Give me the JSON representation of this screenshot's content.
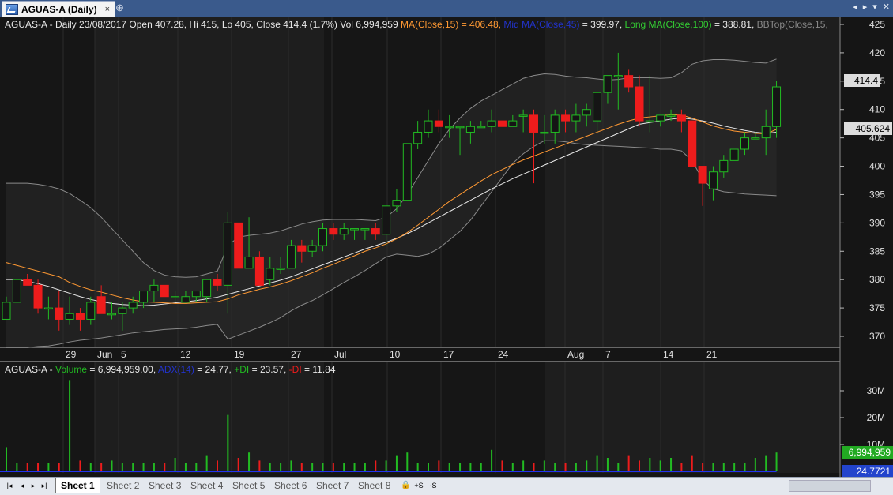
{
  "window": {
    "tab_title": "AGUAS-A (Daily)",
    "tab_icon": "chart-icon",
    "close_glyph": "×",
    "pin_glyph": "⊕",
    "controls": [
      "◂",
      "▸",
      "▾",
      "✕"
    ]
  },
  "price_pane": {
    "info": {
      "main": "AGUAS-A - Daily 23/08/2017 Open 407.28, Hi 415, Lo 405, Close 414.4 (1.7%) Vol 6,994,959",
      "ma15": "MA(Close,15) = 406.48,",
      "mid_ma": "Mid MA(Close,45)",
      "mid_ma_val": "= 399.97,",
      "long_ma": "Long MA(Close,100)",
      "long_ma_val": "= 388.81,",
      "bbtop": "BBTop(Close,15,"
    },
    "y_ticks": [
      "425",
      "420",
      "415",
      "410",
      "405",
      "400",
      "395",
      "390",
      "385",
      "380",
      "375",
      "370"
    ],
    "last_price": "414.4",
    "ma_marker": "405.624",
    "x_labels": [
      "29",
      "Jun",
      "5",
      "12",
      "19",
      "27",
      "Jul",
      "10",
      "17",
      "24",
      "Aug",
      "7",
      "14",
      "21"
    ]
  },
  "volume_pane": {
    "info": {
      "name": "AGUAS-A -",
      "volume_label": "Volume",
      "volume_val": "= 6,994,959.00,",
      "adx_label": "ADX(14)",
      "adx_val": "= 24.77,",
      "pdi_label": "+DI",
      "pdi_val": "= 23.57,",
      "mdi_label": "-DI",
      "mdi_val": "= 11.84"
    },
    "y_ticks": [
      "30M",
      "20M",
      "10M"
    ],
    "last_volume": "6,994,959",
    "last_adx": "24.7721"
  },
  "colors": {
    "up": "#22bb22",
    "down": "#ee1c1c",
    "ma15": "#ff9933",
    "mid_ma": "#2233cc",
    "long_ma": "#33cc33",
    "bb": "#888888",
    "price_box": "#dddddd",
    "adx_box": "#2244cc",
    "volume_box": "#22aa22"
  },
  "sheets": {
    "nav": [
      "|◂",
      "◂",
      "▸",
      "▸|"
    ],
    "tabs": [
      "Sheet 1",
      "Sheet 2",
      "Sheet 3",
      "Sheet 4",
      "Sheet 5",
      "Sheet 6",
      "Sheet 7",
      "Sheet 8"
    ],
    "active": "Sheet 1",
    "tools": [
      "🔒",
      "+S",
      "-S"
    ]
  },
  "chart_data": {
    "type": "candlestick",
    "symbol": "AGUAS-A",
    "interval": "Daily",
    "ylim": [
      367,
      426
    ],
    "volume_ylim": [
      0,
      35000000
    ],
    "candles": [
      {
        "o": 373,
        "h": 377,
        "l": 373,
        "c": 376
      },
      {
        "o": 376,
        "h": 380,
        "l": 376,
        "c": 380
      },
      {
        "o": 380,
        "h": 381,
        "l": 379,
        "c": 379
      },
      {
        "o": 379,
        "h": 380,
        "l": 374,
        "c": 375
      },
      {
        "o": 375,
        "h": 377,
        "l": 373,
        "c": 375
      },
      {
        "o": 375,
        "h": 378,
        "l": 371,
        "c": 373
      },
      {
        "o": 373,
        "h": 377,
        "l": 372,
        "c": 374
      },
      {
        "o": 374,
        "h": 375,
        "l": 371,
        "c": 373
      },
      {
        "o": 373,
        "h": 377,
        "l": 372,
        "c": 376
      },
      {
        "o": 377,
        "h": 379,
        "l": 375,
        "c": 374
      },
      {
        "o": 374,
        "h": 376,
        "l": 373,
        "c": 374
      },
      {
        "o": 374,
        "h": 376,
        "l": 371,
        "c": 375
      },
      {
        "o": 375,
        "h": 377,
        "l": 374,
        "c": 376
      },
      {
        "o": 376,
        "h": 378,
        "l": 375,
        "c": 378
      },
      {
        "o": 378,
        "h": 380,
        "l": 376,
        "c": 379
      },
      {
        "o": 379,
        "h": 379,
        "l": 377,
        "c": 377
      },
      {
        "o": 377,
        "h": 378,
        "l": 376,
        "c": 377
      },
      {
        "o": 376,
        "h": 378,
        "l": 376,
        "c": 377
      },
      {
        "o": 377,
        "h": 378,
        "l": 376,
        "c": 378
      },
      {
        "o": 377,
        "h": 380,
        "l": 376,
        "c": 380
      },
      {
        "o": 380,
        "h": 381,
        "l": 378,
        "c": 379
      },
      {
        "o": 379,
        "h": 392,
        "l": 374,
        "c": 390
      },
      {
        "o": 390,
        "h": 390,
        "l": 382,
        "c": 382
      },
      {
        "o": 382,
        "h": 391,
        "l": 382,
        "c": 384
      },
      {
        "o": 384,
        "h": 385,
        "l": 379,
        "c": 379
      },
      {
        "o": 380,
        "h": 384,
        "l": 379,
        "c": 382
      },
      {
        "o": 382,
        "h": 384,
        "l": 381,
        "c": 382
      },
      {
        "o": 382,
        "h": 387,
        "l": 382,
        "c": 386
      },
      {
        "o": 386,
        "h": 387,
        "l": 383,
        "c": 385
      },
      {
        "o": 385,
        "h": 387,
        "l": 384,
        "c": 386
      },
      {
        "o": 386,
        "h": 390,
        "l": 385,
        "c": 389
      },
      {
        "o": 389,
        "h": 390,
        "l": 387,
        "c": 388
      },
      {
        "o": 388,
        "h": 390,
        "l": 387,
        "c": 389
      },
      {
        "o": 389,
        "h": 389,
        "l": 387,
        "c": 389
      },
      {
        "o": 389,
        "h": 389,
        "l": 387,
        "c": 389
      },
      {
        "o": 389,
        "h": 390,
        "l": 387,
        "c": 388
      },
      {
        "o": 388,
        "h": 393,
        "l": 386,
        "c": 393
      },
      {
        "o": 393,
        "h": 396,
        "l": 392,
        "c": 394
      },
      {
        "o": 394,
        "h": 404,
        "l": 394,
        "c": 404
      },
      {
        "o": 404,
        "h": 408,
        "l": 403,
        "c": 406
      },
      {
        "o": 406,
        "h": 410,
        "l": 405,
        "c": 408
      },
      {
        "o": 408,
        "h": 410,
        "l": 406,
        "c": 407
      },
      {
        "o": 407,
        "h": 409,
        "l": 405,
        "c": 407
      },
      {
        "o": 407,
        "h": 407,
        "l": 402,
        "c": 407
      },
      {
        "o": 406,
        "h": 408,
        "l": 404,
        "c": 407
      },
      {
        "o": 407,
        "h": 408,
        "l": 407,
        "c": 407
      },
      {
        "o": 407,
        "h": 410,
        "l": 406,
        "c": 408
      },
      {
        "o": 408,
        "h": 408,
        "l": 407,
        "c": 407
      },
      {
        "o": 407,
        "h": 409,
        "l": 407,
        "c": 408
      },
      {
        "o": 409,
        "h": 410,
        "l": 406,
        "c": 409
      },
      {
        "o": 409,
        "h": 410,
        "l": 397,
        "c": 406
      },
      {
        "o": 406,
        "h": 409,
        "l": 404,
        "c": 406
      },
      {
        "o": 406,
        "h": 410,
        "l": 404,
        "c": 409
      },
      {
        "o": 409,
        "h": 410,
        "l": 406,
        "c": 408
      },
      {
        "o": 408,
        "h": 411,
        "l": 406,
        "c": 409
      },
      {
        "o": 409,
        "h": 411,
        "l": 407,
        "c": 410
      },
      {
        "o": 408,
        "h": 413,
        "l": 406,
        "c": 413
      },
      {
        "o": 413,
        "h": 416,
        "l": 411,
        "c": 416
      },
      {
        "o": 416,
        "h": 420,
        "l": 410,
        "c": 416
      },
      {
        "o": 416,
        "h": 417,
        "l": 413,
        "c": 414
      },
      {
        "o": 414,
        "h": 416,
        "l": 407,
        "c": 408
      },
      {
        "o": 408,
        "h": 416,
        "l": 406,
        "c": 408
      },
      {
        "o": 408,
        "h": 409,
        "l": 407,
        "c": 409
      },
      {
        "o": 409,
        "h": 410,
        "l": 408,
        "c": 409
      },
      {
        "o": 409,
        "h": 410,
        "l": 406,
        "c": 408
      },
      {
        "o": 408,
        "h": 408,
        "l": 400,
        "c": 400
      },
      {
        "o": 400,
        "h": 400,
        "l": 393,
        "c": 397
      },
      {
        "o": 396,
        "h": 400,
        "l": 394,
        "c": 399
      },
      {
        "o": 399,
        "h": 402,
        "l": 398,
        "c": 401
      },
      {
        "o": 401,
        "h": 403,
        "l": 401,
        "c": 403
      },
      {
        "o": 403,
        "h": 406,
        "l": 402,
        "c": 405
      },
      {
        "o": 405,
        "h": 406,
        "l": 405,
        "c": 405
      },
      {
        "o": 405,
        "h": 410,
        "l": 402,
        "c": 407
      },
      {
        "o": 407,
        "h": 415,
        "l": 405,
        "c": 414
      }
    ],
    "ma15": [
      383,
      382.5,
      382,
      381.5,
      381,
      380.5,
      379.5,
      378.8,
      378.2,
      377.8,
      377.3,
      376.8,
      376.4,
      376.1,
      376,
      375.9,
      375.8,
      375.8,
      375.9,
      376,
      376.1,
      376.6,
      377.3,
      377.8,
      378.3,
      378.7,
      379.2,
      379.8,
      380.5,
      381.2,
      382,
      382.7,
      383.5,
      384.2,
      385,
      385.6,
      386.3,
      387.2,
      388.3,
      389.6,
      391,
      392.4,
      393.8,
      395,
      396.2,
      397.4,
      398.5,
      399.4,
      400.3,
      401.1,
      401.8,
      402.5,
      403.2,
      403.9,
      404.6,
      405.3,
      406,
      406.7,
      407.4,
      408,
      408.5,
      408.7,
      408.9,
      409.1,
      409,
      408.5,
      407.8,
      407.1,
      406.6,
      406.2,
      406,
      405.8,
      405.7,
      406.5
    ],
    "mid_ma": [
      380,
      380,
      379.7,
      379.3,
      378.8,
      378.2,
      377.6,
      377,
      376.5,
      376.1,
      375.8,
      375.6,
      375.5,
      375.4,
      375.5,
      375.7,
      375.9,
      376.1,
      376.3,
      376.6,
      376.9,
      377.4,
      377.9,
      378.4,
      378.9,
      379.4,
      379.9,
      380.5,
      381.2,
      381.9,
      382.6,
      383.3,
      384,
      384.7,
      385.4,
      386,
      386.6,
      387.3,
      388.1,
      389,
      390,
      391,
      392,
      393,
      394,
      395,
      396,
      396.9,
      397.8,
      398.6,
      399.4,
      400.2,
      401,
      401.8,
      402.6,
      403.4,
      404.2,
      405,
      405.8,
      406.6,
      407.4,
      407.7,
      408,
      408.3,
      408.5,
      408.3,
      408,
      407.6,
      407.1,
      406.7,
      406.3,
      406,
      405.8,
      406
    ],
    "bb_top": [
      397,
      397,
      397,
      396.8,
      396.5,
      396,
      395.2,
      394,
      392.7,
      391,
      389,
      387,
      385,
      383,
      381.6,
      380.8,
      380.5,
      380.4,
      380.5,
      381,
      381.5,
      386,
      387.5,
      387.8,
      388,
      388.2,
      388.6,
      389.2,
      389.8,
      390.2,
      390.5,
      390.6,
      390.6,
      390.6,
      390.5,
      390.4,
      391,
      392.5,
      395,
      398,
      401,
      404,
      406.5,
      408.5,
      410.2,
      411.5,
      412.5,
      413.5,
      414.5,
      415.5,
      416,
      416.3,
      416.2,
      415.9,
      415.7,
      415.6,
      415.4,
      415.2,
      415.3,
      415.6,
      415.6,
      415.6,
      415.5,
      415.6,
      416.5,
      418,
      418.6,
      418.8,
      418.8,
      418.7,
      418.5,
      418.3,
      418.2,
      418.9
    ],
    "bb_bot": [
      368,
      368,
      368,
      368.2,
      368.3,
      368.6,
      369,
      369.3,
      369.5,
      369.7,
      370,
      370.3,
      370.6,
      370.8,
      371,
      371.2,
      371.3,
      371.4,
      371.6,
      371.9,
      372.1,
      369.5,
      370.2,
      370.9,
      371.6,
      372.4,
      373.3,
      374.5,
      375.5,
      376.3,
      377.3,
      378.4,
      379.5,
      380.5,
      381.6,
      382.8,
      384,
      384.5,
      384.3,
      384.1,
      384.5,
      385.5,
      387,
      388.5,
      390.5,
      393,
      395.5,
      398,
      400.5,
      402.2,
      403.5,
      404.5,
      404.5,
      404.3,
      404,
      403.8,
      403.7,
      403.6,
      403.5,
      403.4,
      403.3,
      403.2,
      403,
      403,
      402.7,
      401,
      397.6,
      396,
      395.5,
      395.3,
      395.1,
      395,
      394.9,
      394.8
    ],
    "volume": [
      9,
      3,
      3,
      3,
      3,
      3,
      34,
      4,
      3,
      3,
      4,
      3,
      3,
      3,
      3,
      3,
      5,
      3,
      3,
      6,
      4,
      21,
      5,
      7,
      4,
      3,
      3,
      4,
      3,
      3,
      3,
      3,
      3,
      3,
      3,
      4,
      4,
      6,
      7,
      3,
      3,
      4,
      3,
      3,
      3,
      3,
      8,
      4,
      3,
      4,
      3,
      4,
      3,
      3,
      3,
      4,
      6,
      5,
      3,
      6,
      4,
      5,
      4,
      5,
      3,
      6,
      3,
      3,
      3,
      3,
      3,
      5,
      6,
      7
    ]
  }
}
